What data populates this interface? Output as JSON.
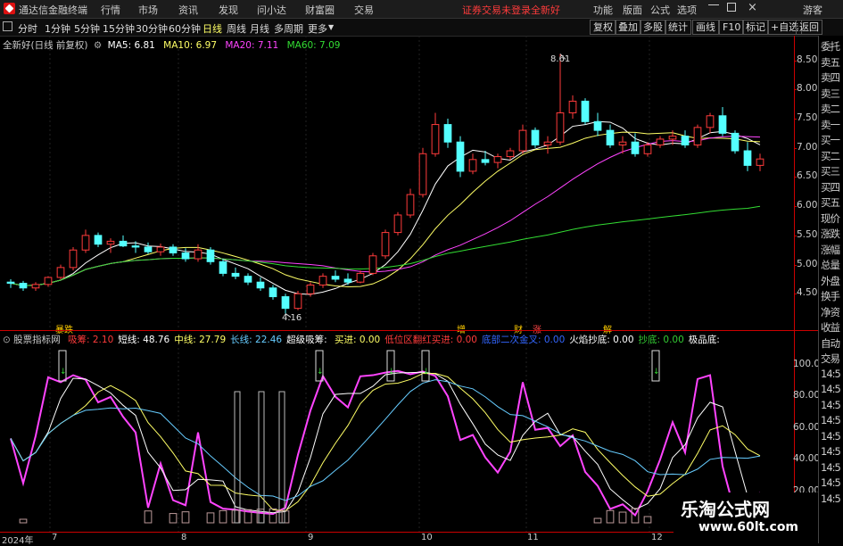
{
  "titlebar": {
    "app_name": "通达信金融终端",
    "menu": [
      "行情",
      "市场",
      "资讯",
      "发现",
      "问小达",
      "财富圈",
      "交易"
    ],
    "login_notice": "证券交易未登录",
    "stock_name": "全新好",
    "right_menu": [
      "功能",
      "版面",
      "公式",
      "选项"
    ],
    "guest": "游客"
  },
  "periodbar": {
    "periods": [
      "分时",
      "1分钟",
      "5分钟",
      "15分钟",
      "30分钟",
      "60分钟",
      "日线",
      "周线",
      "月线",
      "多周期",
      "更多"
    ],
    "active_period": "日线",
    "tools": [
      "复权",
      "叠加",
      "多股",
      "统计",
      "画线",
      "F10",
      "标记",
      "+自选",
      "返回"
    ]
  },
  "main_legend": {
    "title": "全新好(日线 前复权)",
    "ma5": "MA5: 6.81",
    "ma10": "MA10: 6.97",
    "ma20": "MA20: 7.11",
    "ma60": "MA60: 7.09"
  },
  "main_annotations": {
    "high_label": "8.61",
    "low_label": "4.16",
    "markers": [
      "暴跌",
      "增",
      "财",
      "涨",
      "解"
    ]
  },
  "price_axis": [
    "8.50",
    "8.00",
    "7.50",
    "7.00",
    "6.50",
    "6.00",
    "5.50",
    "5.00",
    "4.50"
  ],
  "indicator_legend": {
    "name": "股票指标网",
    "items": [
      {
        "label": "吸筹: 2.10",
        "color": "#ff3b3b"
      },
      {
        "label": "短线: 48.76",
        "color": "#ffffff"
      },
      {
        "label": "中线: 27.79",
        "color": "#ffff66"
      },
      {
        "label": "长线: 22.46",
        "color": "#66ccff"
      },
      {
        "label": "超级吸筹: ",
        "color": "#ffffff"
      },
      {
        "label": "买进: 0.00",
        "color": "#ffff66"
      },
      {
        "label": "低位区翻红买进: 0.00",
        "color": "#ff3b3b"
      },
      {
        "label": "底部二次金叉: 0.00",
        "color": "#3366ff"
      },
      {
        "label": "火焰抄底: 0.00",
        "color": "#ffffff"
      },
      {
        "label": "抄底: 0.00",
        "color": "#33cc33"
      },
      {
        "label": "极品底: ",
        "color": "#ffffff"
      }
    ]
  },
  "indicator_axis": [
    "100.00",
    "80.00",
    "60.00",
    "40.00",
    "20.00"
  ],
  "date_axis": [
    "2024年",
    "7",
    "8",
    "9",
    "10",
    "11",
    "12"
  ],
  "right_panel": [
    "委托",
    "卖五",
    "卖四",
    "卖三",
    "卖二",
    "卖一",
    "买一",
    "买二",
    "买三",
    "买四",
    "买五",
    "现价",
    "涨跌",
    "涨幅",
    "总量",
    "外盘",
    "换手",
    "净资",
    "收益",
    "自动",
    "交易",
    "14:5",
    "14:5",
    "14:5",
    "14:5",
    "14:5",
    "14:5",
    "14:5",
    "14:5",
    "14:5"
  ],
  "watermark": {
    "title": "乐淘公式网",
    "url": "www.60lt.com"
  },
  "chart_data": {
    "type": "candlestick",
    "title": "全新好(日线 前复权)",
    "ylim": [
      4.0,
      8.8
    ],
    "series_names": [
      "MA5",
      "MA10",
      "MA20",
      "MA60"
    ],
    "candles": [
      [
        4.7,
        4.75,
        4.6,
        4.68
      ],
      [
        4.68,
        4.72,
        4.55,
        4.6
      ],
      [
        4.6,
        4.7,
        4.55,
        4.66
      ],
      [
        4.66,
        4.8,
        4.62,
        4.78
      ],
      [
        4.78,
        5.0,
        4.75,
        4.95
      ],
      [
        4.95,
        5.3,
        4.9,
        5.25
      ],
      [
        5.25,
        5.6,
        5.2,
        5.5
      ],
      [
        5.5,
        5.55,
        5.3,
        5.35
      ],
      [
        5.35,
        5.45,
        5.2,
        5.4
      ],
      [
        5.4,
        5.5,
        5.3,
        5.32
      ],
      [
        5.32,
        5.4,
        5.2,
        5.3
      ],
      [
        5.3,
        5.38,
        5.18,
        5.22
      ],
      [
        5.22,
        5.36,
        5.15,
        5.3
      ],
      [
        5.3,
        5.35,
        5.15,
        5.2
      ],
      [
        5.2,
        5.28,
        5.05,
        5.1
      ],
      [
        5.1,
        5.35,
        5.05,
        5.25
      ],
      [
        5.25,
        5.3,
        5.0,
        5.05
      ],
      [
        5.05,
        5.1,
        4.8,
        4.85
      ],
      [
        4.85,
        4.95,
        4.75,
        4.8
      ],
      [
        4.8,
        4.85,
        4.65,
        4.7
      ],
      [
        4.7,
        4.78,
        4.55,
        4.6
      ],
      [
        4.6,
        4.65,
        4.4,
        4.45
      ],
      [
        4.45,
        4.5,
        4.16,
        4.25
      ],
      [
        4.25,
        4.55,
        4.22,
        4.5
      ],
      [
        4.5,
        4.7,
        4.45,
        4.65
      ],
      [
        4.65,
        4.85,
        4.6,
        4.8
      ],
      [
        4.8,
        4.9,
        4.7,
        4.75
      ],
      [
        4.75,
        4.85,
        4.65,
        4.7
      ],
      [
        4.7,
        4.9,
        4.68,
        4.85
      ],
      [
        4.85,
        5.2,
        4.82,
        5.15
      ],
      [
        5.15,
        5.6,
        5.1,
        5.55
      ],
      [
        5.55,
        5.9,
        5.5,
        5.85
      ],
      [
        5.85,
        6.3,
        5.8,
        6.2
      ],
      [
        6.2,
        7.0,
        6.15,
        6.9
      ],
      [
        6.9,
        7.6,
        6.85,
        7.4
      ],
      [
        7.4,
        7.5,
        7.0,
        7.1
      ],
      [
        7.1,
        7.2,
        6.5,
        6.6
      ],
      [
        6.6,
        6.9,
        6.55,
        6.8
      ],
      [
        6.8,
        6.95,
        6.7,
        6.75
      ],
      [
        6.75,
        6.9,
        6.65,
        6.85
      ],
      [
        6.85,
        7.0,
        6.8,
        6.95
      ],
      [
        6.95,
        7.4,
        6.9,
        7.3
      ],
      [
        7.3,
        7.35,
        7.0,
        7.05
      ],
      [
        7.05,
        7.2,
        6.9,
        7.1
      ],
      [
        7.1,
        8.61,
        7.05,
        7.6
      ],
      [
        7.6,
        7.9,
        7.5,
        7.8
      ],
      [
        7.8,
        7.85,
        7.4,
        7.45
      ],
      [
        7.45,
        7.6,
        7.2,
        7.3
      ],
      [
        7.3,
        7.4,
        7.0,
        7.05
      ],
      [
        7.05,
        7.2,
        6.9,
        7.1
      ],
      [
        7.1,
        7.25,
        6.85,
        6.9
      ],
      [
        6.9,
        7.1,
        6.85,
        7.05
      ],
      [
        7.05,
        7.2,
        7.0,
        7.15
      ],
      [
        7.15,
        7.3,
        7.05,
        7.2
      ],
      [
        7.2,
        7.3,
        7.0,
        7.05
      ],
      [
        7.05,
        7.4,
        7.0,
        7.35
      ],
      [
        7.35,
        7.6,
        7.25,
        7.55
      ],
      [
        7.55,
        7.7,
        7.2,
        7.25
      ],
      [
        7.25,
        7.3,
        6.9,
        6.95
      ],
      [
        6.95,
        7.1,
        6.6,
        6.7
      ],
      [
        6.7,
        6.9,
        6.6,
        6.81
      ]
    ]
  }
}
